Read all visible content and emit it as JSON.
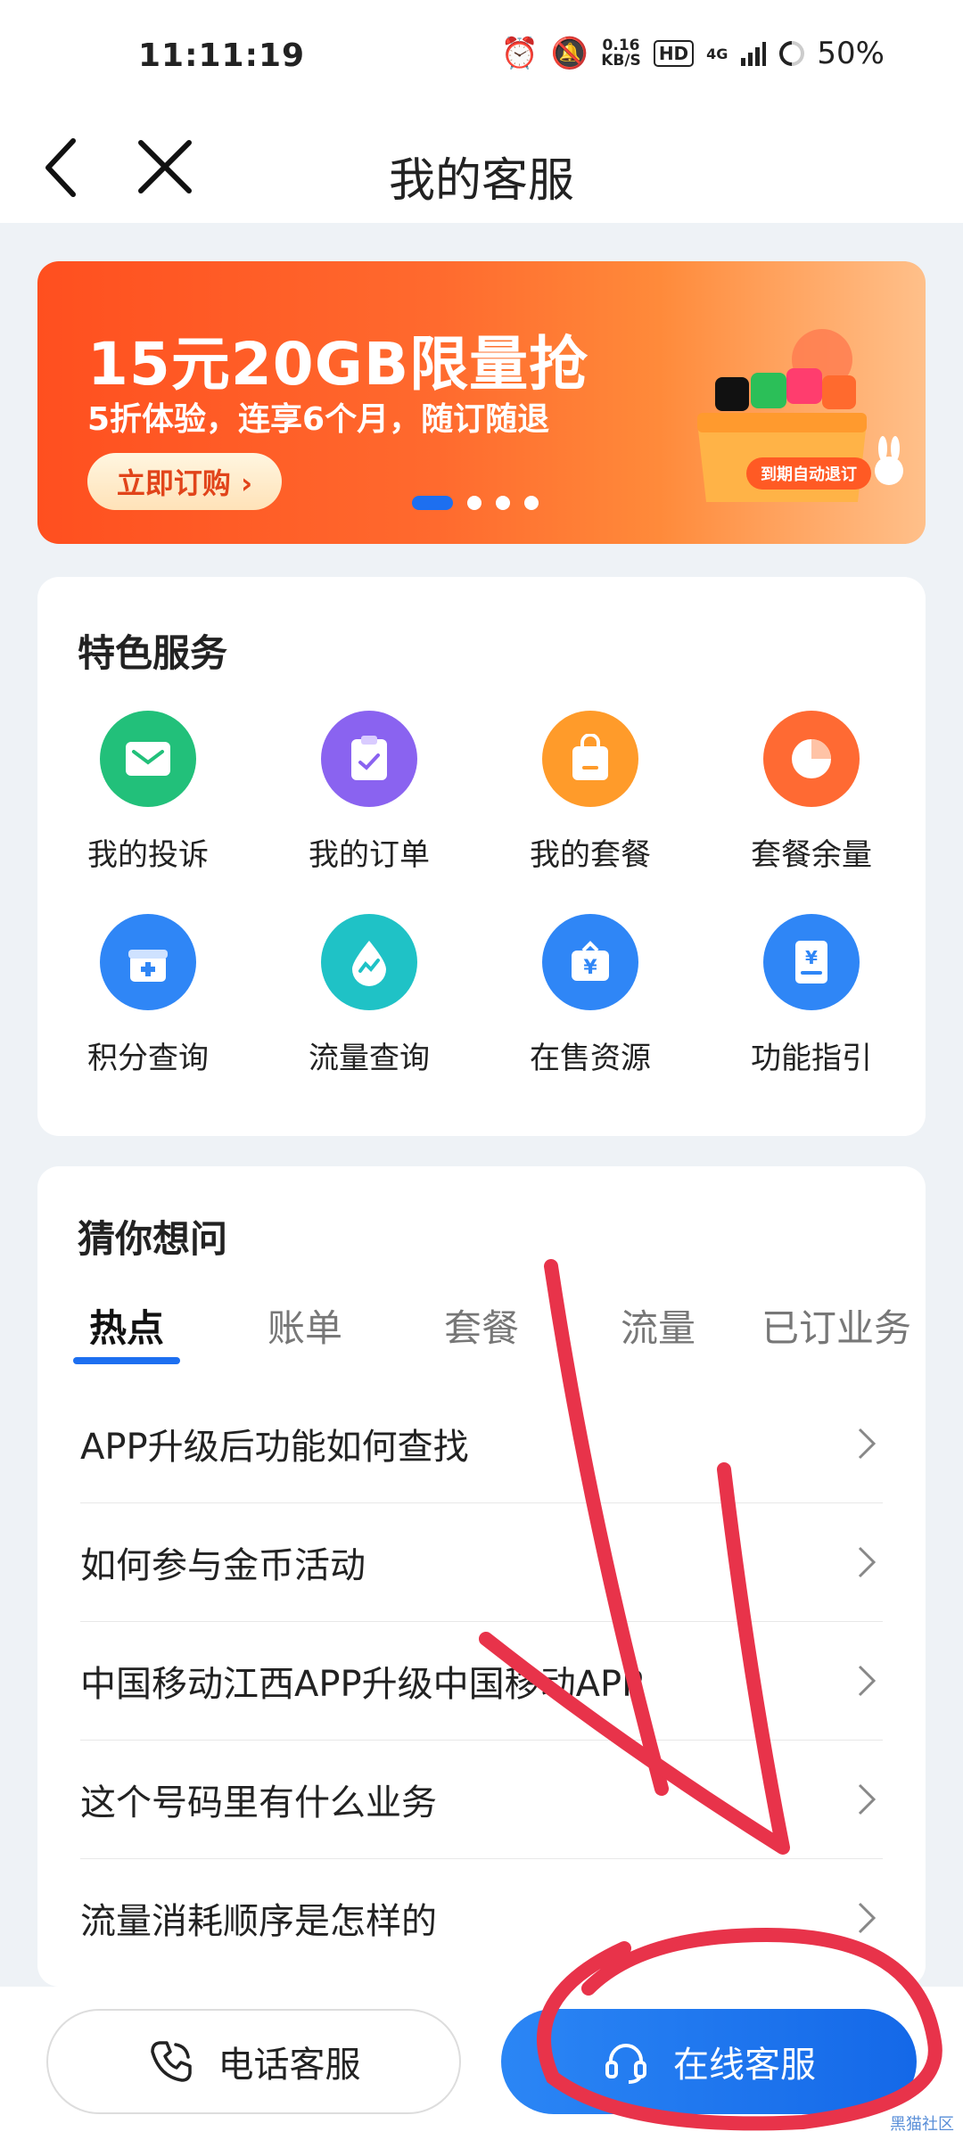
{
  "status": {
    "time": "11:11:19",
    "netspeed_value": "0.16",
    "netspeed_unit": "KB/S",
    "hd": "HD",
    "network": "4G",
    "battery": "50%"
  },
  "nav": {
    "title": "我的客服"
  },
  "banner": {
    "title": "15元20GB限量抢",
    "subtitle": "5折体验，连享6个月，随订随退",
    "button": "立即订购 ›",
    "gift_label": "到期自动退订",
    "slide_count": 4,
    "active_slide": 1
  },
  "services": {
    "title": "特色服务",
    "items": [
      {
        "label": "我的投诉",
        "icon": "mail-icon",
        "color": "#22c07a"
      },
      {
        "label": "我的订单",
        "icon": "clipboard-check-icon",
        "color": "#8a63f0"
      },
      {
        "label": "我的套餐",
        "icon": "bag-icon",
        "color": "#ff9b2a"
      },
      {
        "label": "套餐余量",
        "icon": "pie-chart-icon",
        "color": "#ff6a33"
      },
      {
        "label": "积分查询",
        "icon": "gift-box-icon",
        "color": "#2f86f6"
      },
      {
        "label": "流量查询",
        "icon": "droplet-icon",
        "color": "#1fc2c6"
      },
      {
        "label": "在售资源",
        "icon": "yen-sign-icon",
        "color": "#2f86f6"
      },
      {
        "label": "功能指引",
        "icon": "guide-book-icon",
        "color": "#2f86f6"
      }
    ]
  },
  "guess": {
    "title": "猜你想问",
    "tabs": [
      "热点",
      "账单",
      "套餐",
      "流量",
      "已订业务"
    ],
    "active_tab": 0,
    "questions": [
      "APP升级后功能如何查找",
      "如何参与金币活动",
      "中国移动江西APP升级中国移动APP",
      "这个号码里有什么业务",
      "流量消耗顺序是怎样的"
    ]
  },
  "bottom": {
    "phone": "电话客服",
    "online": "在线客服",
    "watermark": "黑猫社区"
  },
  "colors": {
    "accent": "#1d6ff0",
    "banner": "#ff5a24",
    "annotation": "#e8334a"
  }
}
